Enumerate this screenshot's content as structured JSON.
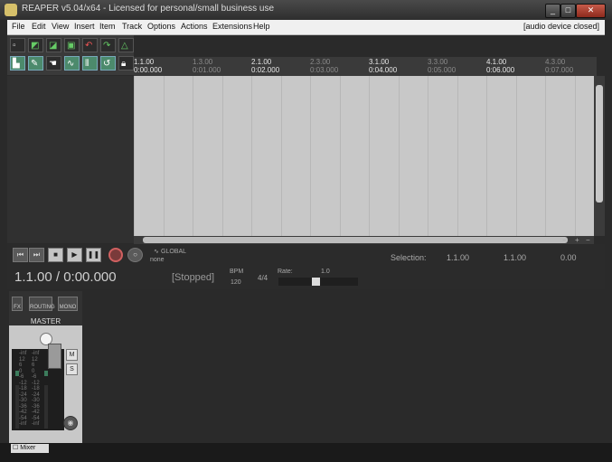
{
  "window": {
    "title": "REAPER v5.04/x64 - Licensed for personal/small business use",
    "controls": [
      "_",
      "□",
      "✕"
    ]
  },
  "menubar": {
    "items": [
      "File",
      "Edit",
      "View",
      "Insert",
      "Item",
      "Track",
      "Options",
      "Actions",
      "Extensions",
      "Help"
    ],
    "device_status": "[audio device closed]"
  },
  "timeline": {
    "marks": [
      {
        "bar": "1.1.00",
        "time": "0:00.000",
        "major": true
      },
      {
        "bar": "1.3.00",
        "time": "0:01.000",
        "major": false
      },
      {
        "bar": "2.1.00",
        "time": "0:02.000",
        "major": true
      },
      {
        "bar": "2.3.00",
        "time": "0:03.000",
        "major": false
      },
      {
        "bar": "3.1.00",
        "time": "0:04.000",
        "major": true
      },
      {
        "bar": "3.3.00",
        "time": "0:05.000",
        "major": false
      },
      {
        "bar": "4.1.00",
        "time": "0:06.000",
        "major": true
      },
      {
        "bar": "4.3.00",
        "time": "0:07.000",
        "major": false
      }
    ]
  },
  "transport": {
    "global_label": "GLOBAL",
    "global_value": "none",
    "timecode": "1.1.00 / 0:00.000",
    "status": "[Stopped]",
    "bpm_label": "BPM",
    "bpm": "120",
    "time_sig": "4/4",
    "rate_label": "Rate:",
    "rate_value": "1.0",
    "selection_label": "Selection:",
    "selection_start": "1.1.00",
    "selection_end": "1.1.00",
    "selection_length": "0.00"
  },
  "mixer": {
    "fx_label": "FX",
    "routing_label": "ROUTING",
    "mono_label": "MONO",
    "master_label": "MASTER",
    "mute": "M",
    "solo": "S",
    "scale": [
      "-inf",
      "12",
      "6",
      "0",
      "-6",
      "-12",
      "-18",
      "-24",
      "-30",
      "-36",
      "-42",
      "-54",
      "-inf"
    ],
    "tab_label": "Mixer"
  },
  "colors": {
    "accent_green": "#4c8a6c",
    "record_red": "#d06060",
    "arrange_bg": "#c8c8c8"
  }
}
